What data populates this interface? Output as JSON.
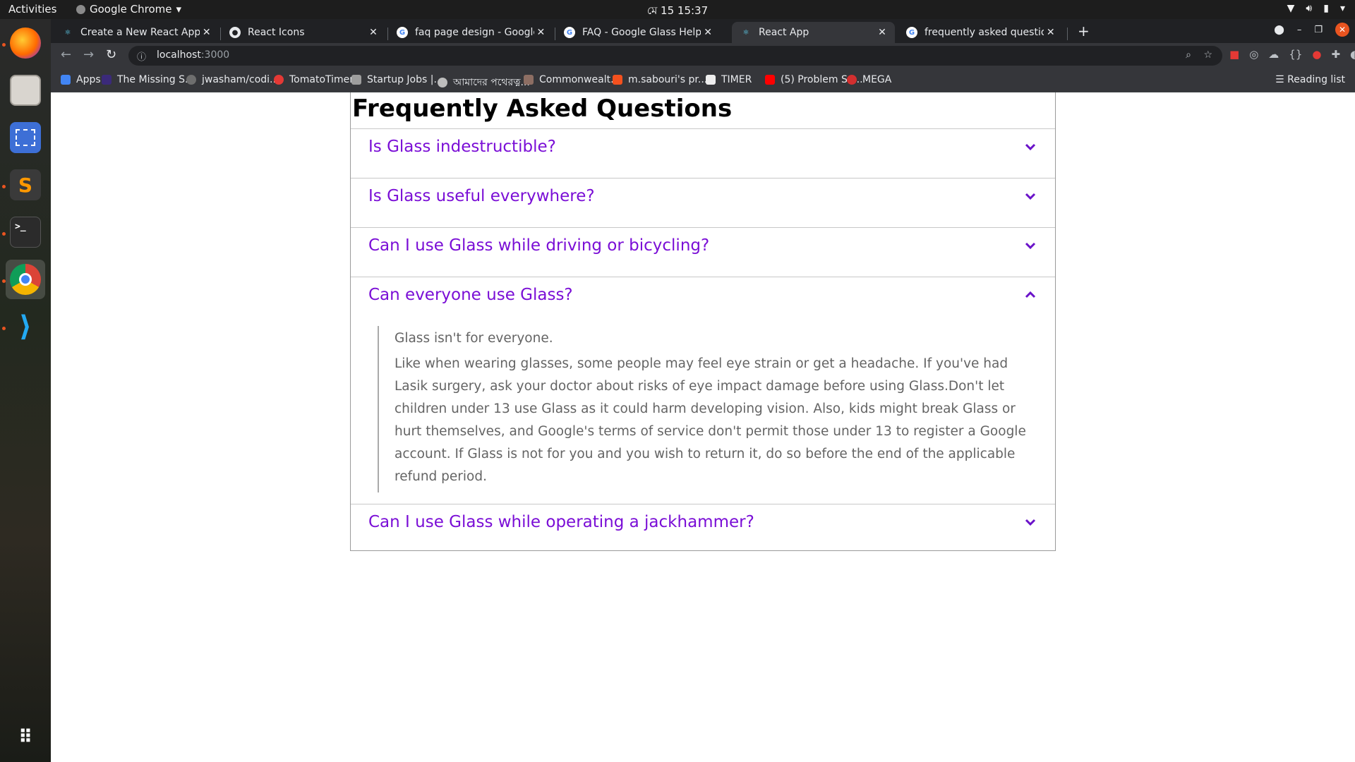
{
  "system": {
    "activities": "Activities",
    "app_name": "Google Chrome",
    "clock": "মে 15  15:37"
  },
  "browser": {
    "tabs": [
      {
        "title": "Create a New React App –",
        "favicon": "react-icon",
        "active": false
      },
      {
        "title": "React Icons",
        "favicon": "github-icon",
        "active": false
      },
      {
        "title": "faq page design - Google",
        "favicon": "google-icon",
        "active": false
      },
      {
        "title": "FAQ - Google Glass Help",
        "favicon": "google-icon",
        "active": false
      },
      {
        "title": "React App",
        "favicon": "react-icon",
        "active": true
      },
      {
        "title": "frequently asked question",
        "favicon": "google-icon",
        "active": false
      }
    ],
    "url_host": "localhost",
    "url_port": ":3000",
    "bookmarks": [
      {
        "label": "Apps",
        "color": "#4285f4"
      },
      {
        "label": "The Missing S...",
        "color": "#3b2a7a"
      },
      {
        "label": "jwasham/codi...",
        "color": "#6e6e6e"
      },
      {
        "label": "TomatoTimer",
        "color": "#e53935"
      },
      {
        "label": "Startup Jobs |...",
        "color": "#9e9e9e"
      },
      {
        "label": "আমাদের পথেরত্ন...",
        "color": "#bdbdbd"
      },
      {
        "label": "Commonwealt...",
        "color": "#8d6e63"
      },
      {
        "label": "m.sabouri's pr...",
        "color": "#f4511e"
      },
      {
        "label": "TIMER",
        "color": "#eeeeee"
      },
      {
        "label": "(5) Problem So...",
        "color": "#ff0000"
      },
      {
        "label": "MEGA",
        "color": "#d32f2f"
      }
    ],
    "reading_list": "Reading list"
  },
  "faq": {
    "title": "Frequently Asked Questions",
    "items": [
      {
        "question": "Is Glass indestructible?",
        "expanded": false
      },
      {
        "question": "Is Glass useful everywhere?",
        "expanded": false
      },
      {
        "question": "Can I use Glass while driving or bicycling?",
        "expanded": false
      },
      {
        "question": "Can everyone use Glass?",
        "expanded": true,
        "answer_intro": "Glass isn't for everyone.",
        "answer_body": "Like when wearing glasses, some people may feel eye strain or get a headache. If you've had Lasik surgery, ask your doctor about risks of eye impact damage before using Glass.Don't let children under 13 use Glass as it could harm developing vision. Also, kids might break Glass or hurt themselves, and Google's terms of service don't permit those under 13 to register a Google account. If Glass is not for you and you wish to return it, do so before the end of the applicable refund period."
      },
      {
        "question": "Can I use Glass while operating a jackhammer?",
        "expanded": false
      }
    ]
  },
  "colors": {
    "question": "#7a0ed6",
    "answer": "#646464"
  }
}
